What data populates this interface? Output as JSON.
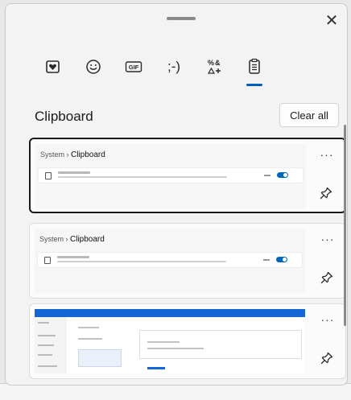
{
  "panel": {
    "close_glyph": "✕"
  },
  "tabs": [
    {
      "name": "kaomoji-favorites-icon"
    },
    {
      "name": "emoji-icon"
    },
    {
      "name": "gif-icon",
      "label": "GIF"
    },
    {
      "name": "kaomoji-icon",
      "label": ";-)"
    },
    {
      "name": "symbols-icon",
      "label": "%&"
    },
    {
      "name": "clipboard-icon",
      "active": true
    }
  ],
  "clipboard": {
    "title": "Clipboard",
    "clear_all_label": "Clear all"
  },
  "items": [
    {
      "breadcrumb_prefix": "System  ›  ",
      "breadcrumb_page": "Clipboard",
      "more_glyph": "···",
      "pinned": false
    },
    {
      "breadcrumb_prefix": "System  ›  ",
      "breadcrumb_page": "Clipboard",
      "more_glyph": "···",
      "pinned": false
    },
    {
      "more_glyph": "···",
      "pinned": false
    }
  ],
  "colors": {
    "accent": "#005fb8",
    "toggle_on": "#0067c0",
    "panel_bg": "#f3f3f3"
  }
}
